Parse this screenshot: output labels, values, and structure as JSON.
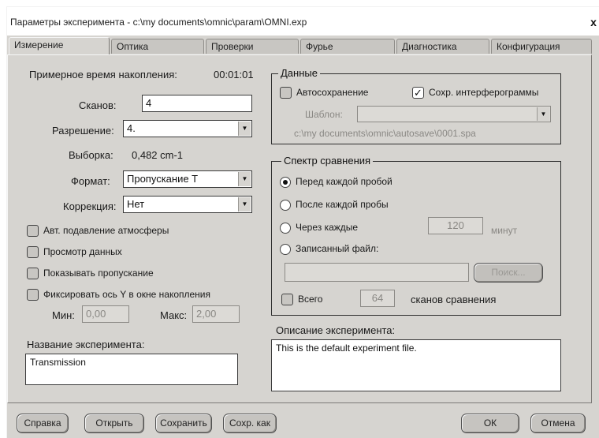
{
  "window": {
    "title": "Параметры эксперимента - c:\\my documents\\omnic\\param\\OMNI.exp",
    "close_glyph": "x"
  },
  "tabs": [
    {
      "label": "Измерение",
      "active": true
    },
    {
      "label": "Оптика",
      "active": false
    },
    {
      "label": "Проверки",
      "active": false
    },
    {
      "label": "Фурье",
      "active": false
    },
    {
      "label": "Диагностика",
      "active": false
    },
    {
      "label": "Конфигурация",
      "active": false
    }
  ],
  "measurement": {
    "approx_time_label": "Примерное время накопления:",
    "approx_time_value": "00:01:01",
    "scans_label": "Сканов:",
    "scans_value": "4",
    "resolution_label": "Разрешение:",
    "resolution_value": "4.",
    "spacing_label": "Выборка:",
    "spacing_value": "0,482 cm-1",
    "format_label": "Формат:",
    "format_value": "Пропускание Т",
    "correction_label": "Коррекция:",
    "correction_value": "Нет",
    "atm_suppress_label": "Авт. подавление атмосферы",
    "preview_label": "Просмотр данных",
    "show_transmission_label": "Показывать пропускание",
    "fix_y_label": "Фиксировать ось Y в окне накопления",
    "min_label": "Мин:",
    "min_value": "0,00",
    "max_label": "Макс:",
    "max_value": "2,00",
    "exp_name_label": "Название эксперимента:",
    "exp_name_value": "Transmission"
  },
  "data_group": {
    "title": "Данные",
    "autosave_label": "Автосохранение",
    "autosave_checked": false,
    "save_interferograms_label": "Сохр. интерферограммы",
    "save_interferograms_checked": true,
    "template_label": "Шаблон:",
    "template_value": "",
    "path_value": "c:\\my documents\\omnic\\autosave\\0001.spa"
  },
  "background_group": {
    "title": "Спектр сравнения",
    "option_before": "Перед каждой пробой",
    "option_after": "После каждой пробы",
    "option_every": "Через каждые",
    "every_value": "120",
    "every_unit": "минут",
    "option_file": "Записанный файл:",
    "file_value": "",
    "browse_label": "Поиск...",
    "total_label": "Всего",
    "total_value": "64",
    "total_suffix": "сканов сравнения",
    "selected": "before"
  },
  "description": {
    "label": "Описание эксперимента:",
    "value": "This is the default experiment file."
  },
  "buttons": {
    "help": "Справка",
    "open": "Открыть",
    "save": "Сохранить",
    "save_as": "Сохр. как",
    "ok": "ОК",
    "cancel": "Отмена"
  }
}
